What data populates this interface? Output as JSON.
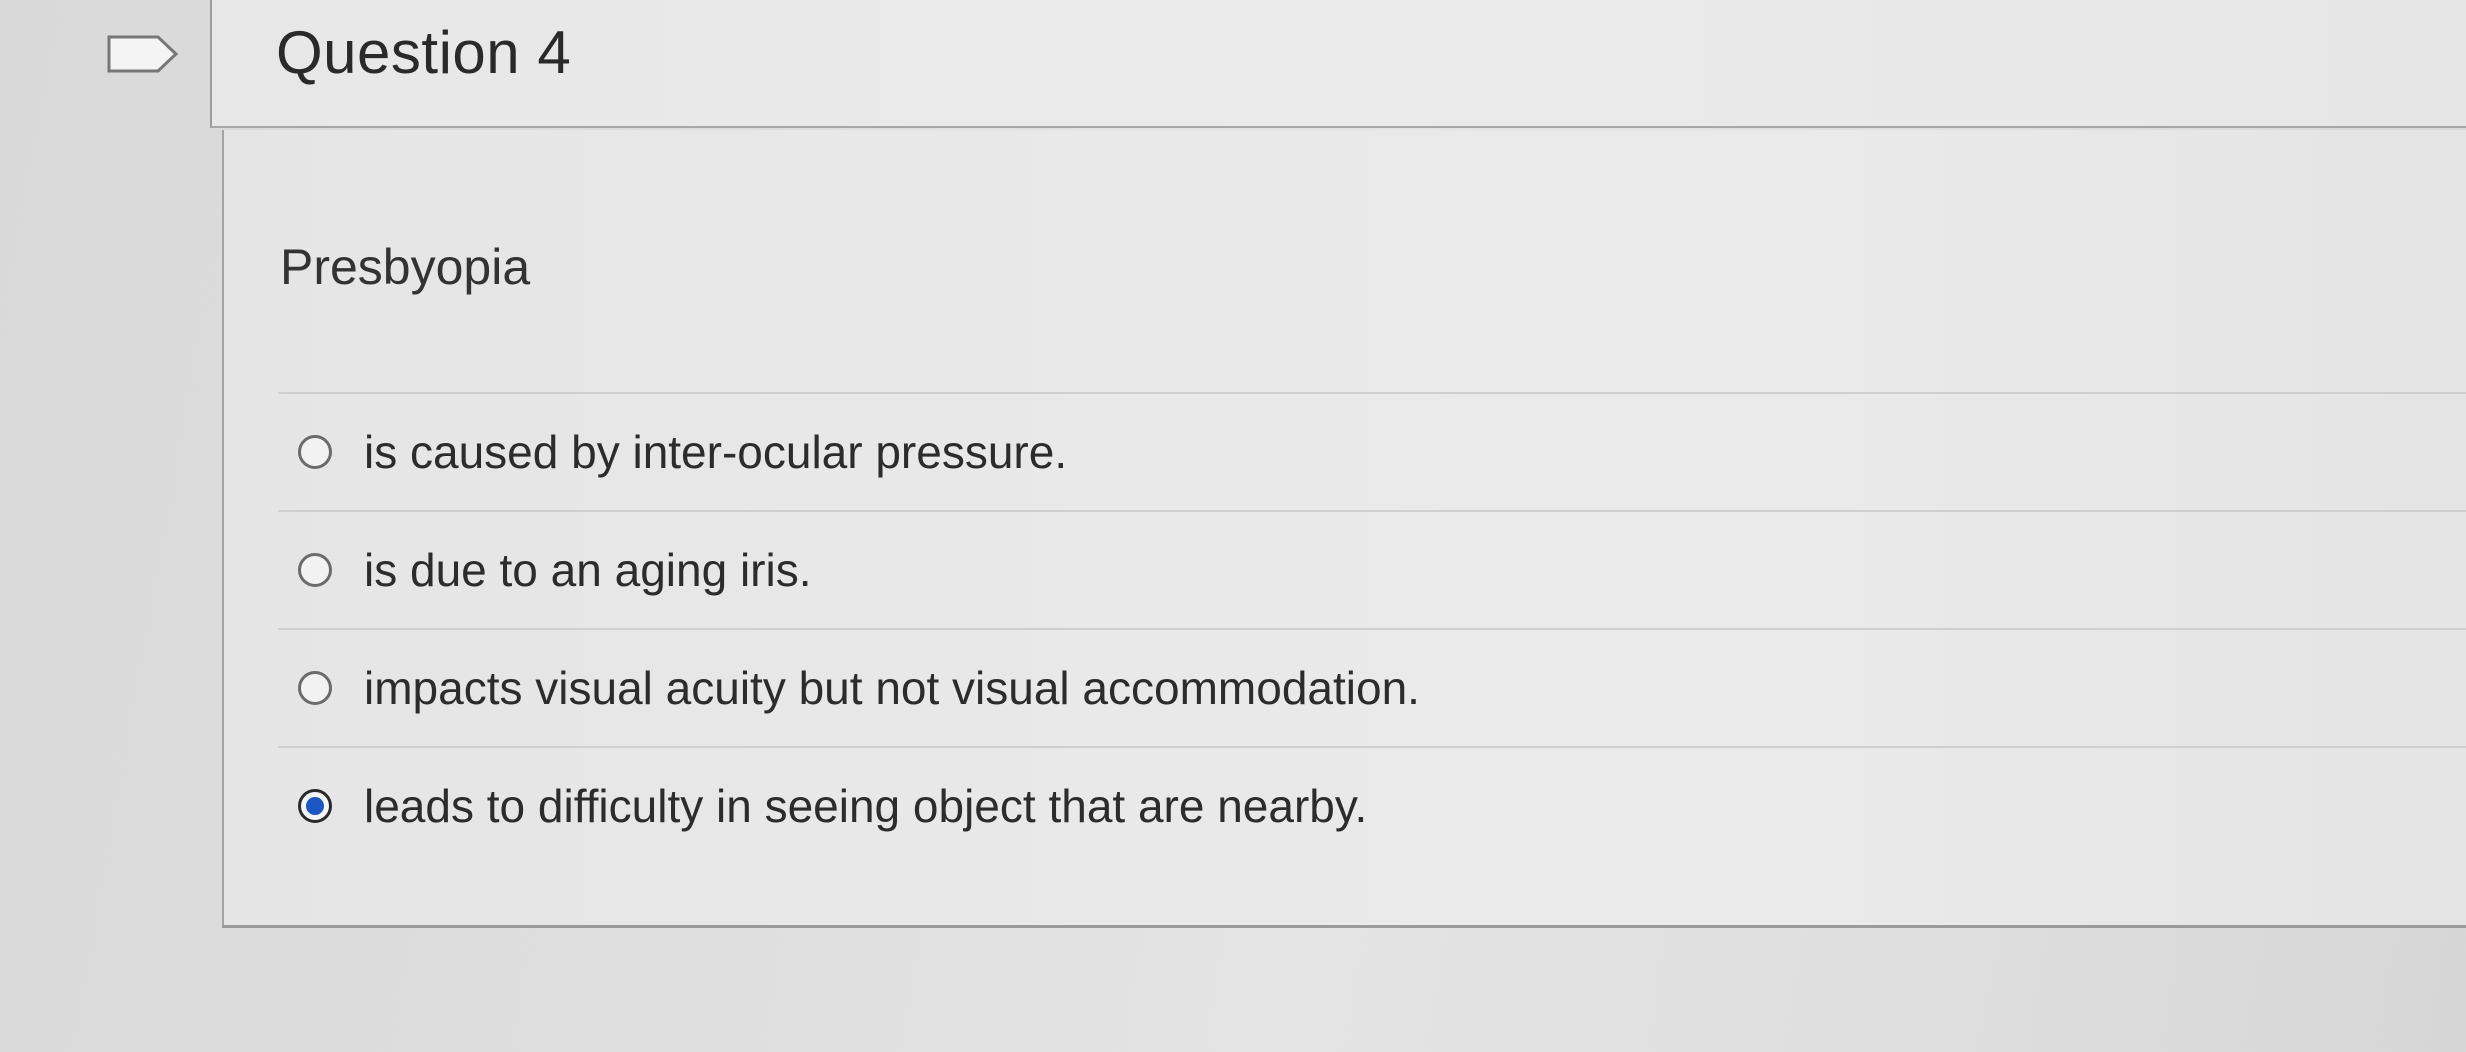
{
  "question": {
    "title": "Question 4",
    "prompt": "Presbyopia",
    "flag_icon": "flag-icon",
    "answers": [
      {
        "text": "is caused by inter-ocular pressure.",
        "selected": false
      },
      {
        "text": "is due to an aging iris.",
        "selected": false
      },
      {
        "text": "impacts visual acuity but not visual accommodation.",
        "selected": false
      },
      {
        "text": "leads to difficulty in seeing object that are nearby.",
        "selected": true
      }
    ]
  },
  "colors": {
    "selected_radio": "#1a56c4",
    "background": "#e0e0e0"
  }
}
